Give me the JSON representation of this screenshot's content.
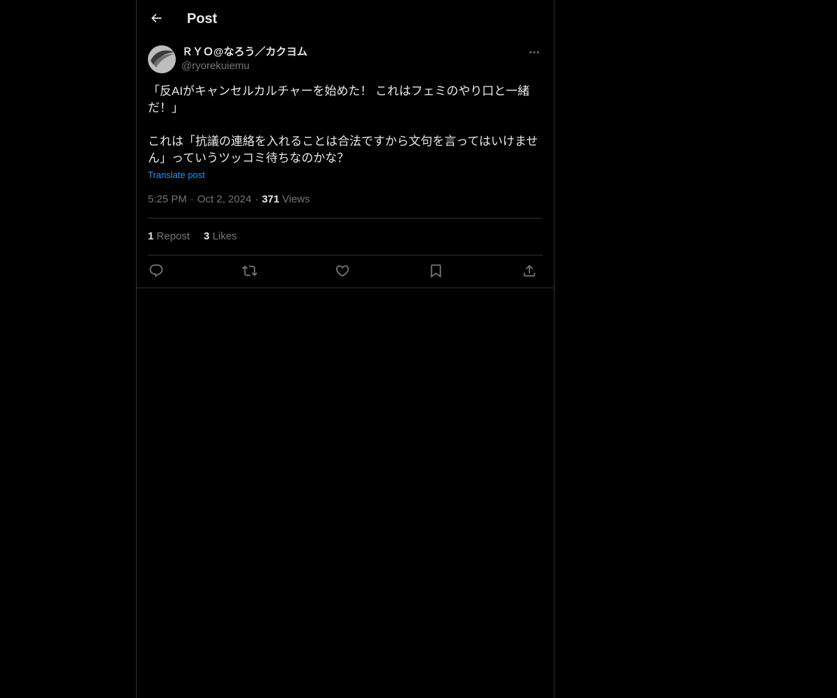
{
  "header": {
    "title": "Post",
    "back_icon": "arrow-left-icon"
  },
  "author": {
    "display_name": "ＲＹＯ@なろう／カクヨム",
    "handle": "@ryorekuiemu",
    "more_icon": "more-horizontal-icon"
  },
  "post": {
    "text": "「反AIがキャンセルカルチャーを始めた！ これはフェミのやり口と一緒だ！」\n\nこれは「抗議の連絡を入れることは合法ですから文句を言ってはいけません」っていうツッコミ待ちなのかな？",
    "translate_label": "Translate post",
    "time": "5:25 PM",
    "date": "Oct 2, 2024",
    "views_count": "371",
    "views_label": "Views",
    "separator": "·"
  },
  "stats": {
    "reposts_count": "1",
    "reposts_label": "Repost",
    "likes_count": "3",
    "likes_label": "Likes"
  },
  "actions": [
    {
      "name": "reply",
      "icon": "reply-icon"
    },
    {
      "name": "repost",
      "icon": "repost-icon"
    },
    {
      "name": "like",
      "icon": "heart-icon"
    },
    {
      "name": "bookmark",
      "icon": "bookmark-icon"
    },
    {
      "name": "share",
      "icon": "share-icon"
    }
  ],
  "colors": {
    "background": "#000000",
    "text_primary": "#e7e9ea",
    "text_secondary": "#71767b",
    "link": "#1d9bf0",
    "border": "#2f3336"
  }
}
